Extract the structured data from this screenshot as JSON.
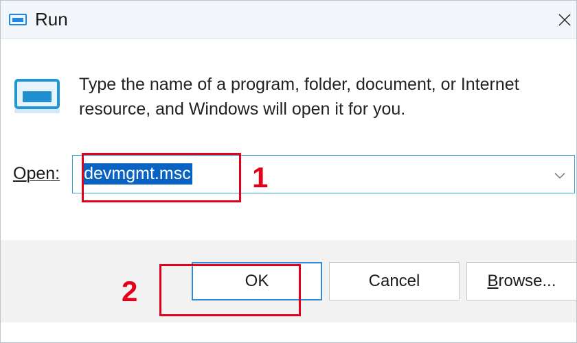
{
  "titlebar": {
    "title": "Run"
  },
  "instruction": "Type the name of a program, folder, document, or Internet resource, and Windows will open it for you.",
  "open": {
    "label": "Open:",
    "value": "devmgmt.msc"
  },
  "buttons": {
    "ok": "OK",
    "cancel": "Cancel",
    "browse": "Browse..."
  },
  "annotations": {
    "num1": "1",
    "num2": "2"
  }
}
